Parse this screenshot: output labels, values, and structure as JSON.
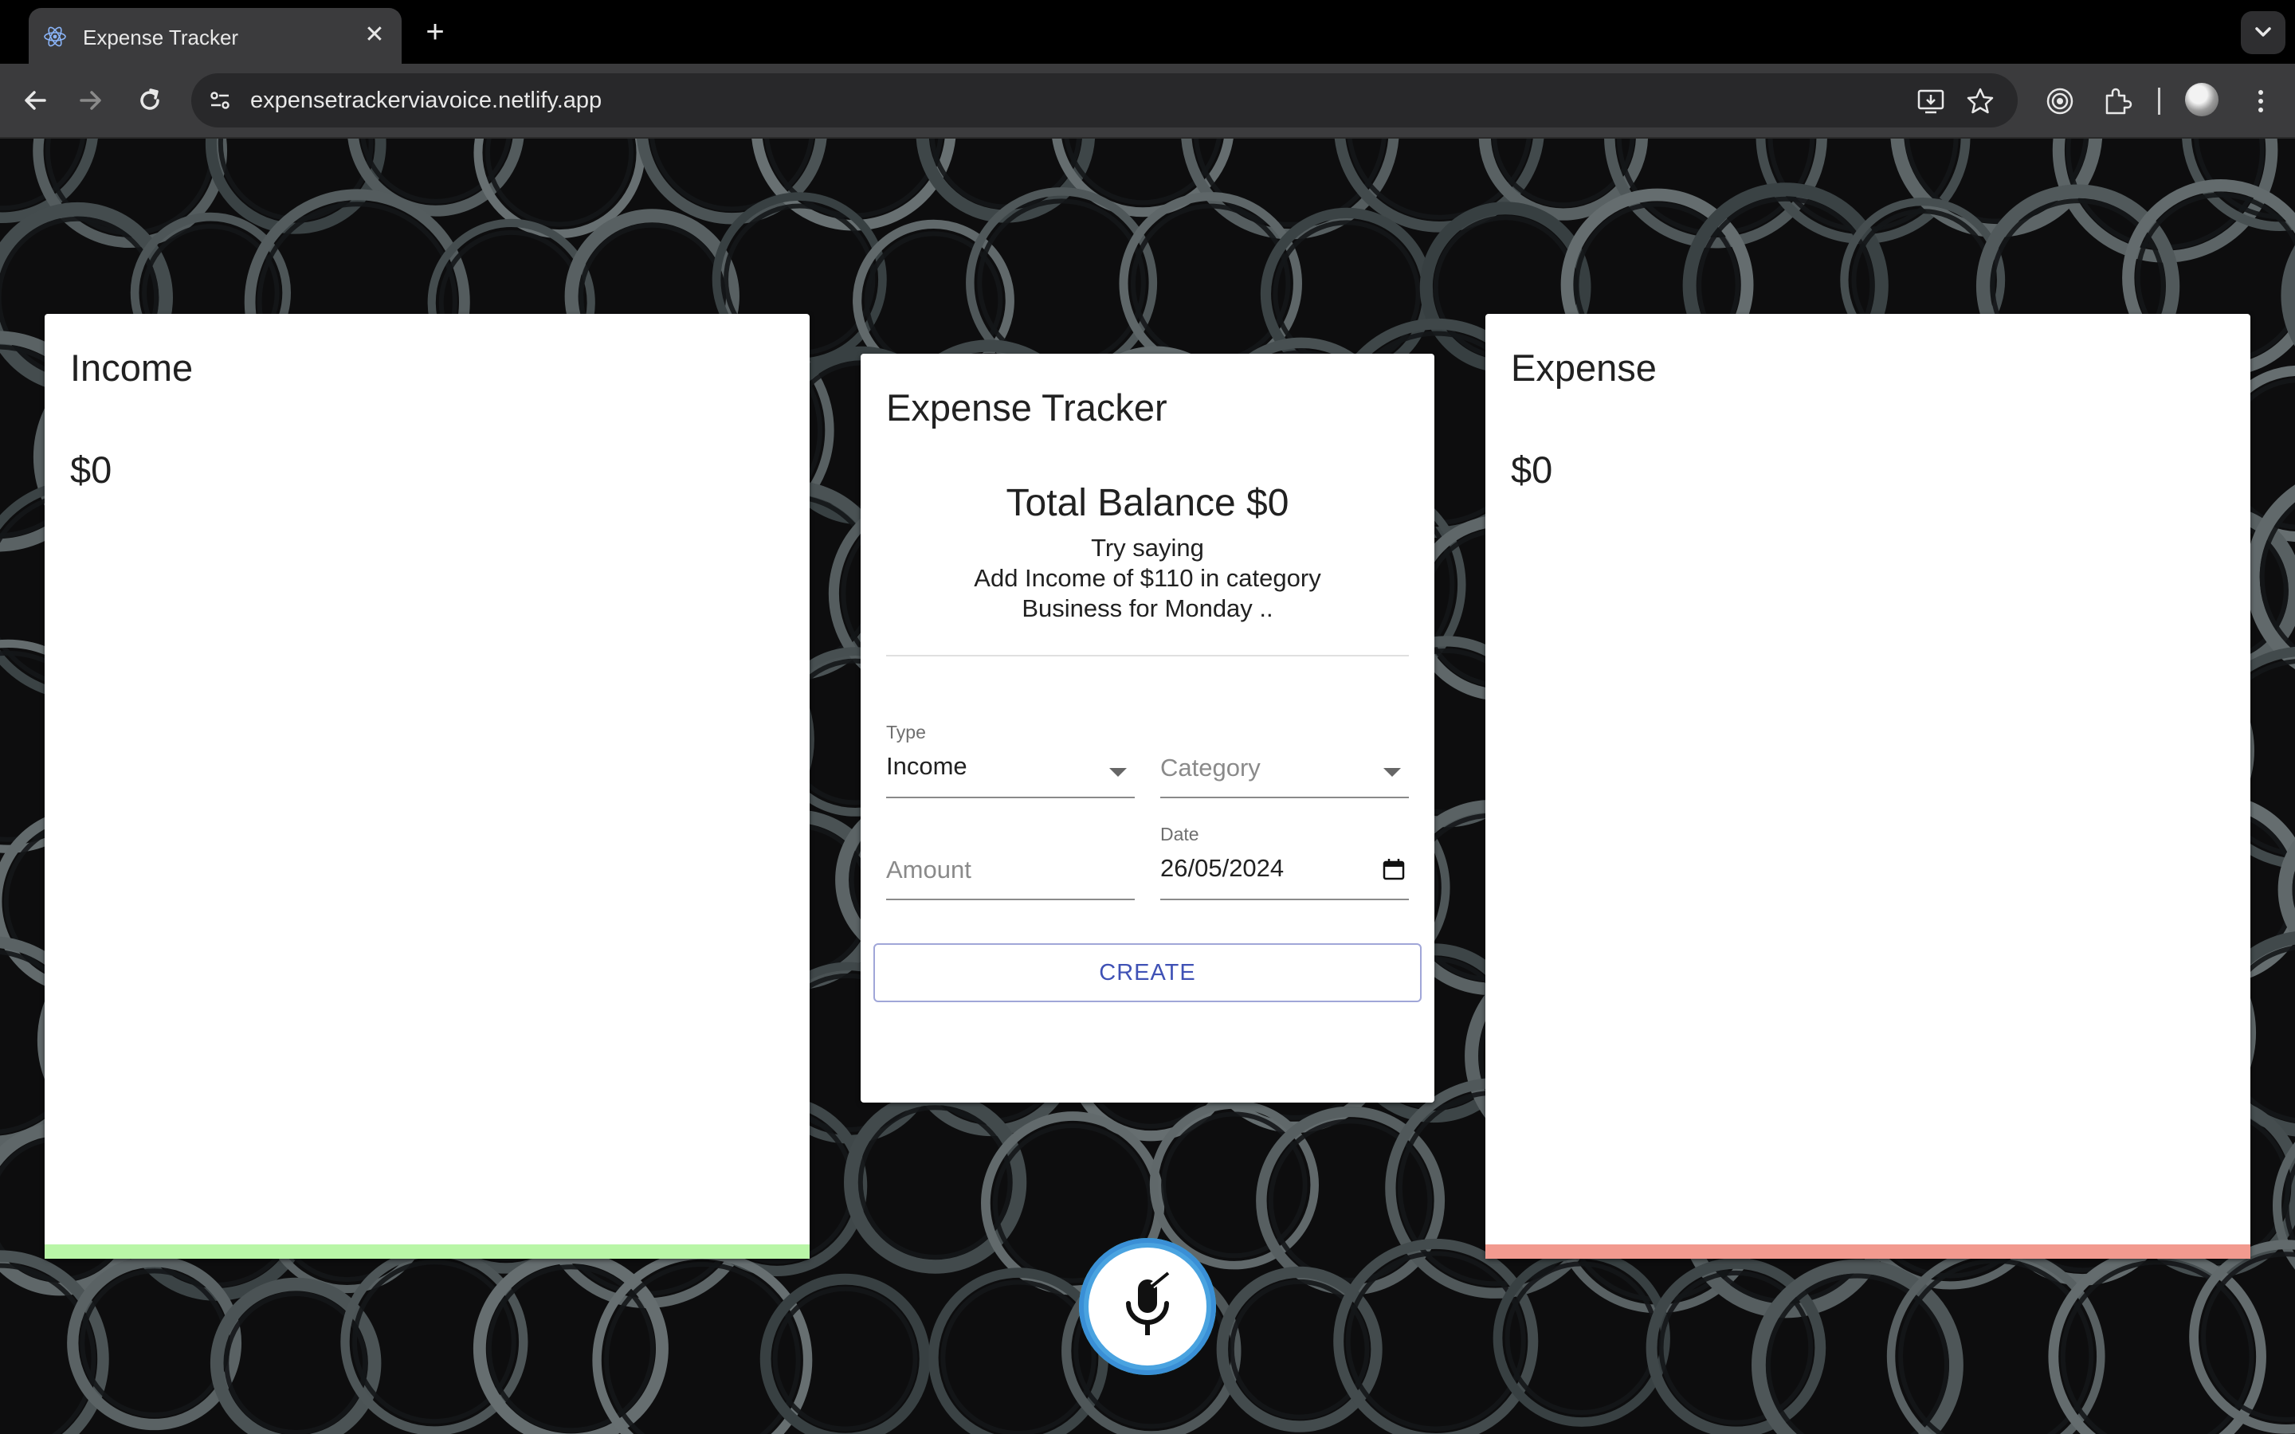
{
  "browser": {
    "tab_title": "Expense Tracker",
    "url": "expensetrackerviavoice.netlify.app",
    "icons": [
      "react-logo-icon",
      "close-icon",
      "plus-icon",
      "chevron-down-icon",
      "back-arrow-icon",
      "forward-arrow-icon",
      "reload-icon",
      "site-info-icon",
      "install-app-icon",
      "bookmark-star-icon",
      "extension-target-icon",
      "puzzle-icon",
      "avatar",
      "kebab-menu-icon"
    ]
  },
  "income": {
    "title": "Income",
    "amount": "$0",
    "accent": "#b9f6a7"
  },
  "expense": {
    "title": "Expense",
    "amount": "$0",
    "accent": "#f29a8f"
  },
  "tracker": {
    "title": "Expense Tracker",
    "balance": "Total Balance $0",
    "hint_line1": "Try saying",
    "hint_line2": "Add Income of $110 in category",
    "hint_line3": "Business for Monday ..",
    "form": {
      "type_label": "Type",
      "type_value": "Income",
      "category_placeholder": "Category",
      "amount_placeholder": "Amount",
      "date_label": "Date",
      "date_value": "26/05/2024",
      "create_label": "CREATE"
    }
  },
  "colors": {
    "button_text": "#3f51b5",
    "mic_ring_start": "#3a8fd6",
    "mic_ring_end": "#47d6a0"
  }
}
